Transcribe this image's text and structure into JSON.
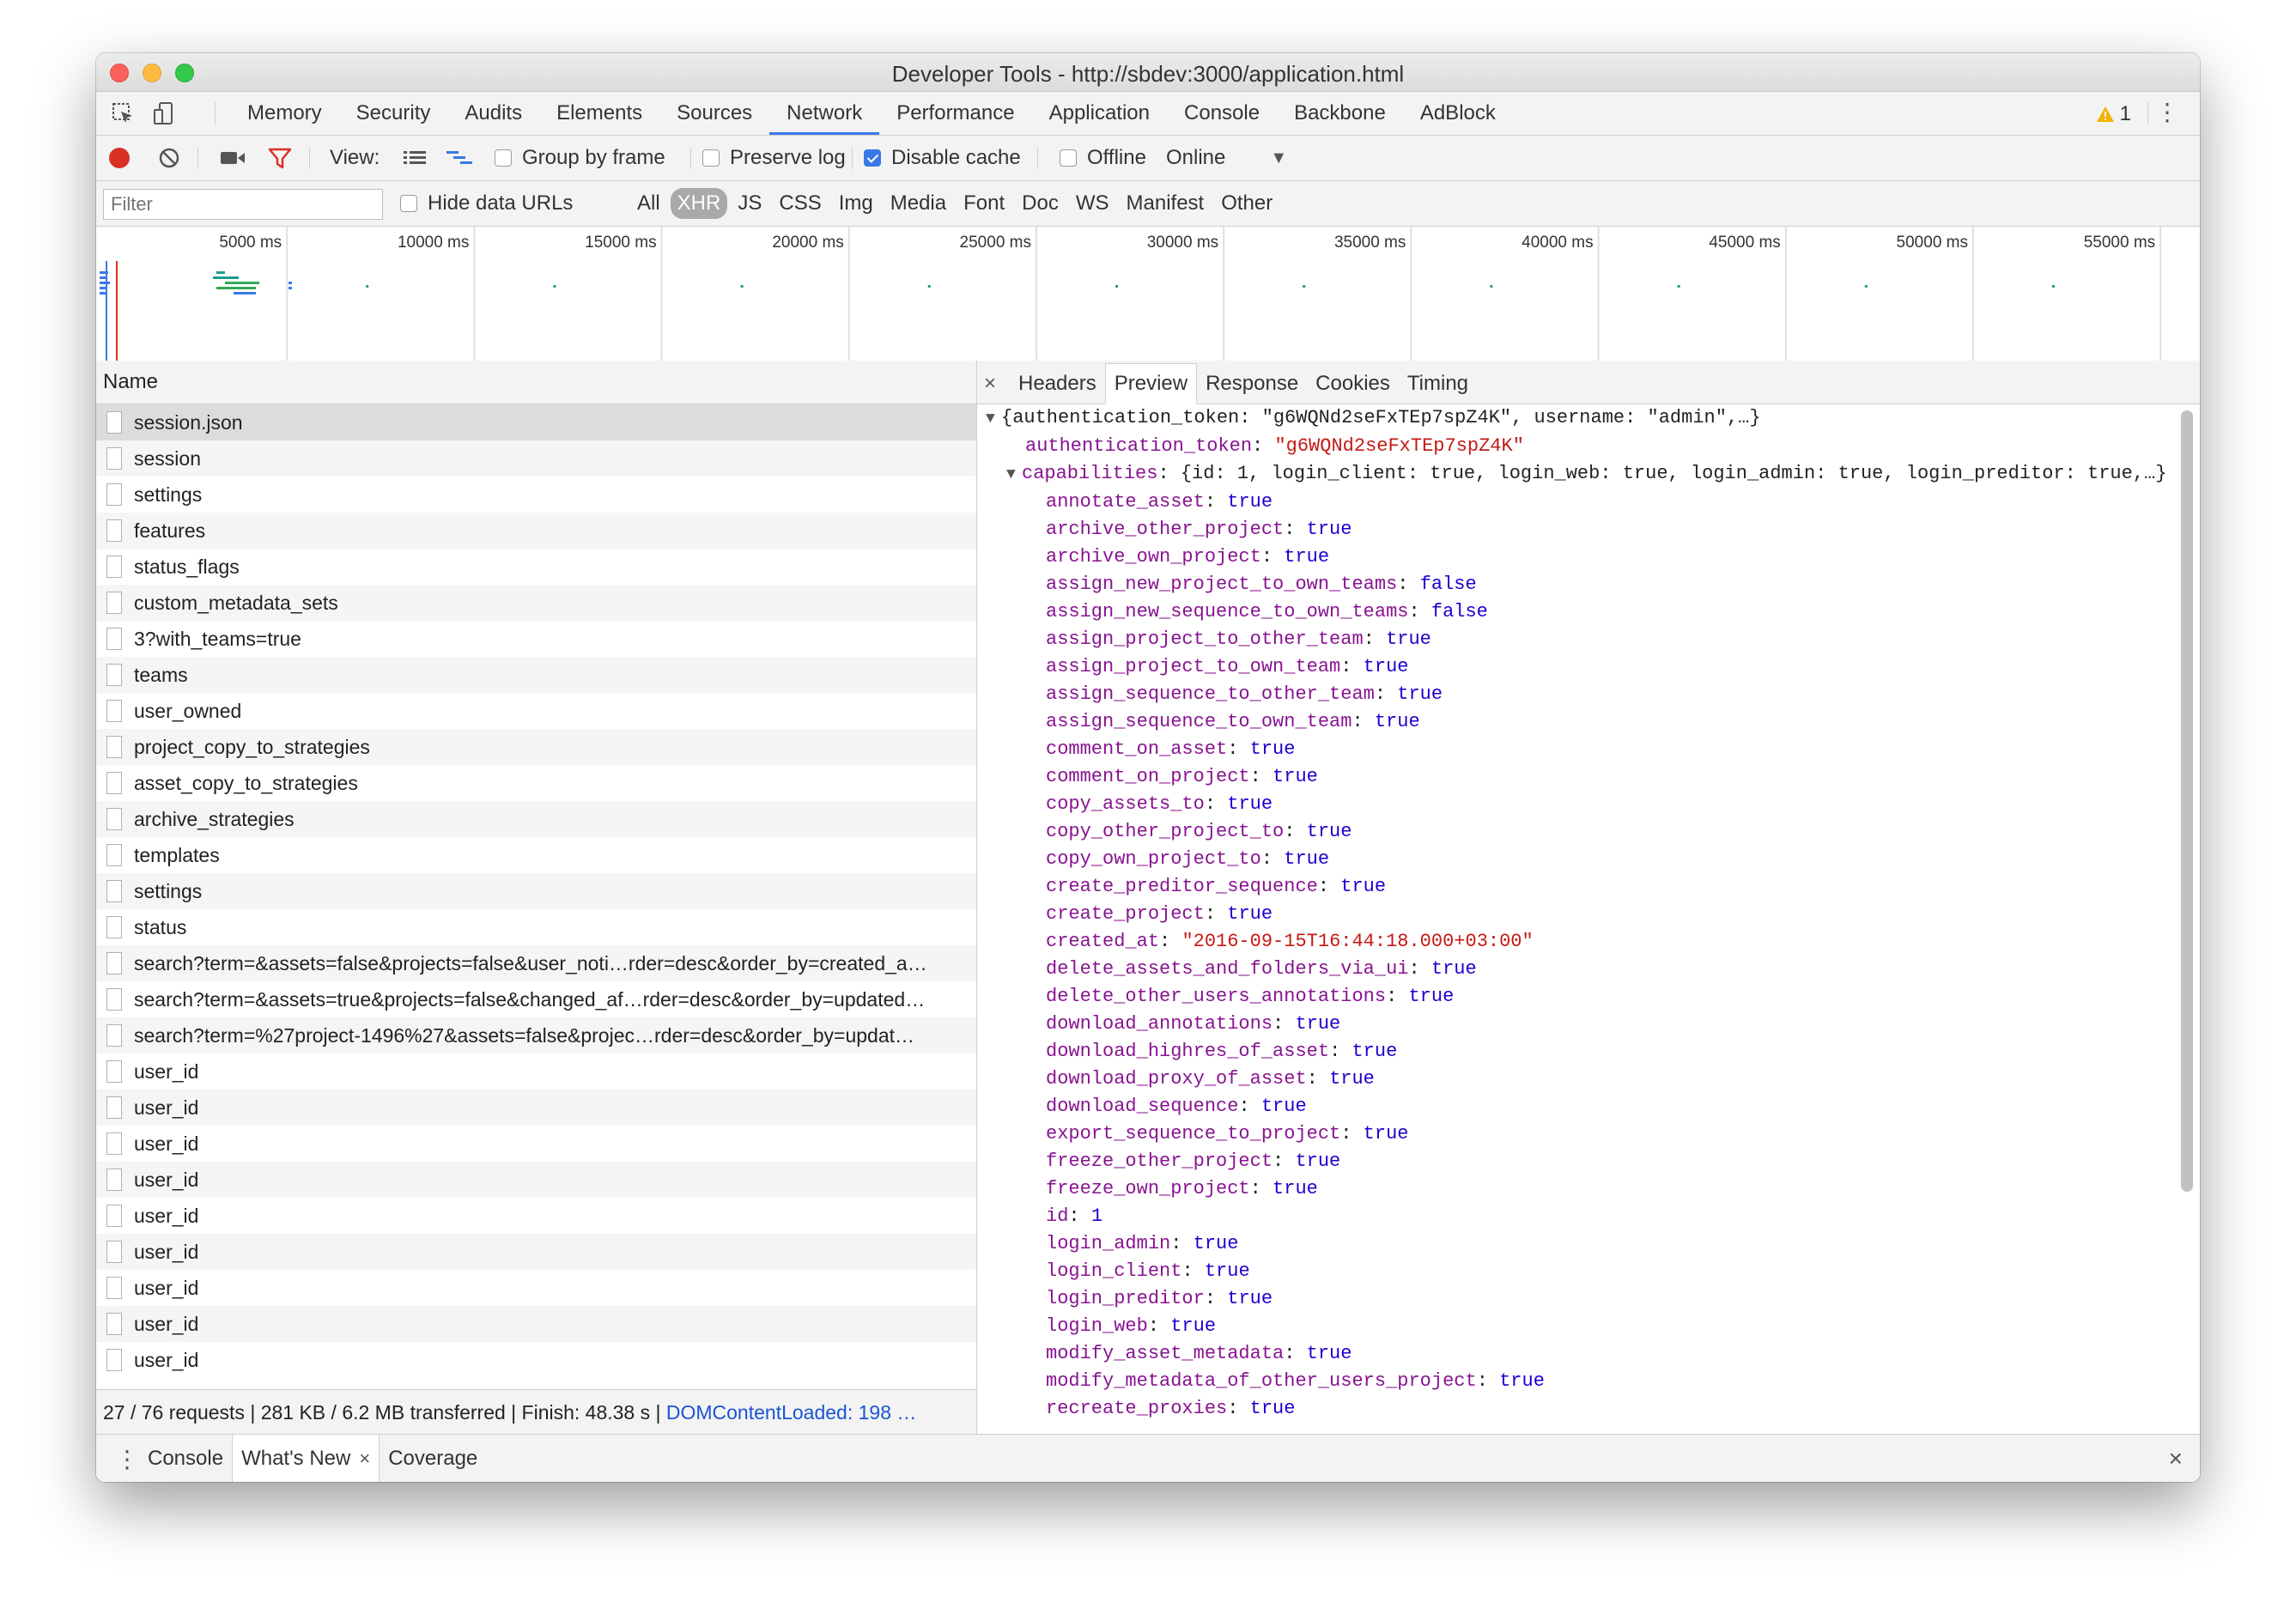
{
  "window": {
    "title": "Developer Tools - http://sbdev:3000/application.html"
  },
  "main_tabs": [
    {
      "label": "Memory"
    },
    {
      "label": "Security"
    },
    {
      "label": "Audits"
    },
    {
      "label": "Elements"
    },
    {
      "label": "Sources"
    },
    {
      "label": "Network",
      "active": true
    },
    {
      "label": "Performance"
    },
    {
      "label": "Application"
    },
    {
      "label": "Console"
    },
    {
      "label": "Backbone"
    },
    {
      "label": "AdBlock"
    }
  ],
  "warnings": {
    "count": "1"
  },
  "network_toolbar": {
    "view_label": "View:",
    "group_by_frame": "Group by frame",
    "preserve_log": "Preserve log",
    "disable_cache": "Disable cache",
    "offline": "Offline",
    "throttle": "Online",
    "disable_cache_checked": true
  },
  "filter_bar": {
    "placeholder": "Filter",
    "hide_data_urls": "Hide data URLs",
    "types": [
      "All",
      "XHR",
      "JS",
      "CSS",
      "Img",
      "Media",
      "Font",
      "Doc",
      "WS",
      "Manifest",
      "Other"
    ],
    "active_type": "XHR"
  },
  "timeline": {
    "ticks": [
      "5000 ms",
      "10000 ms",
      "15000 ms",
      "20000 ms",
      "25000 ms",
      "30000 ms",
      "35000 ms",
      "40000 ms",
      "45000 ms",
      "50000 ms",
      "55000 ms"
    ]
  },
  "requests": {
    "column_name": "Name",
    "items": [
      "session.json",
      "session",
      "settings",
      "features",
      "status_flags",
      "custom_metadata_sets",
      "3?with_teams=true",
      "teams",
      "user_owned",
      "project_copy_to_strategies",
      "asset_copy_to_strategies",
      "archive_strategies",
      "templates",
      "settings",
      "status",
      "search?term=&assets=false&projects=false&user_noti…rder=desc&order_by=created_a…",
      "search?term=&assets=true&projects=false&changed_af…rder=desc&order_by=updated…",
      "search?term=%27project-1496%27&assets=false&projec…rder=desc&order_by=updat…",
      "user_id",
      "user_id",
      "user_id",
      "user_id",
      "user_id",
      "user_id",
      "user_id",
      "user_id",
      "user_id"
    ],
    "selected_index": 0
  },
  "status_bar": {
    "summary": "27 / 76 requests | 281 KB / 6.2 MB transferred | Finish: 48.38 s | ",
    "dom_loaded": "DOMContentLoaded: 198 …"
  },
  "detail_tabs": {
    "close": "×",
    "tabs": [
      "Headers",
      "Preview",
      "Response",
      "Cookies",
      "Timing"
    ],
    "active": "Preview"
  },
  "preview": {
    "root_summary": "{authentication_token: \"g6WQNd2seFxTEp7spZ4K\", username: \"admin\",…}",
    "auth_key": "authentication_token",
    "auth_value": "\"g6WQNd2seFxTEp7spZ4K\"",
    "capabilities_key": "capabilities",
    "capabilities_summary": "{id: 1, login_client: true, login_web: true, login_admin: true, login_preditor: true,…}",
    "props": [
      {
        "k": "annotate_asset",
        "v": "true",
        "t": "val"
      },
      {
        "k": "archive_other_project",
        "v": "true",
        "t": "val"
      },
      {
        "k": "archive_own_project",
        "v": "true",
        "t": "val"
      },
      {
        "k": "assign_new_project_to_own_teams",
        "v": "false",
        "t": "val"
      },
      {
        "k": "assign_new_sequence_to_own_teams",
        "v": "false",
        "t": "val"
      },
      {
        "k": "assign_project_to_other_team",
        "v": "true",
        "t": "val"
      },
      {
        "k": "assign_project_to_own_team",
        "v": "true",
        "t": "val"
      },
      {
        "k": "assign_sequence_to_other_team",
        "v": "true",
        "t": "val"
      },
      {
        "k": "assign_sequence_to_own_team",
        "v": "true",
        "t": "val"
      },
      {
        "k": "comment_on_asset",
        "v": "true",
        "t": "val"
      },
      {
        "k": "comment_on_project",
        "v": "true",
        "t": "val"
      },
      {
        "k": "copy_assets_to",
        "v": "true",
        "t": "val"
      },
      {
        "k": "copy_other_project_to",
        "v": "true",
        "t": "val"
      },
      {
        "k": "copy_own_project_to",
        "v": "true",
        "t": "val"
      },
      {
        "k": "create_preditor_sequence",
        "v": "true",
        "t": "val"
      },
      {
        "k": "create_project",
        "v": "true",
        "t": "val"
      },
      {
        "k": "created_at",
        "v": "\"2016-09-15T16:44:18.000+03:00\"",
        "t": "str"
      },
      {
        "k": "delete_assets_and_folders_via_ui",
        "v": "true",
        "t": "val"
      },
      {
        "k": "delete_other_users_annotations",
        "v": "true",
        "t": "val"
      },
      {
        "k": "download_annotations",
        "v": "true",
        "t": "val"
      },
      {
        "k": "download_highres_of_asset",
        "v": "true",
        "t": "val"
      },
      {
        "k": "download_proxy_of_asset",
        "v": "true",
        "t": "val"
      },
      {
        "k": "download_sequence",
        "v": "true",
        "t": "val"
      },
      {
        "k": "export_sequence_to_project",
        "v": "true",
        "t": "val"
      },
      {
        "k": "freeze_other_project",
        "v": "true",
        "t": "val"
      },
      {
        "k": "freeze_own_project",
        "v": "true",
        "t": "val"
      },
      {
        "k": "id",
        "v": "1",
        "t": "val"
      },
      {
        "k": "login_admin",
        "v": "true",
        "t": "val"
      },
      {
        "k": "login_client",
        "v": "true",
        "t": "val"
      },
      {
        "k": "login_preditor",
        "v": "true",
        "t": "val"
      },
      {
        "k": "login_web",
        "v": "true",
        "t": "val"
      },
      {
        "k": "modify_asset_metadata",
        "v": "true",
        "t": "val"
      },
      {
        "k": "modify_metadata_of_other_users_project",
        "v": "true",
        "t": "val"
      },
      {
        "k": "recreate_proxies",
        "v": "true",
        "t": "val"
      }
    ]
  },
  "drawer": {
    "tabs": [
      "Console",
      "What's New",
      "Coverage"
    ],
    "active": "What's New",
    "tab_close": "×",
    "close": "×"
  },
  "colors": {
    "accent": "#3b78e7",
    "record": "#d93025",
    "filter_icon": "#d93025",
    "key": "#881391",
    "string": "#c41a16",
    "value": "#1c00cf"
  }
}
